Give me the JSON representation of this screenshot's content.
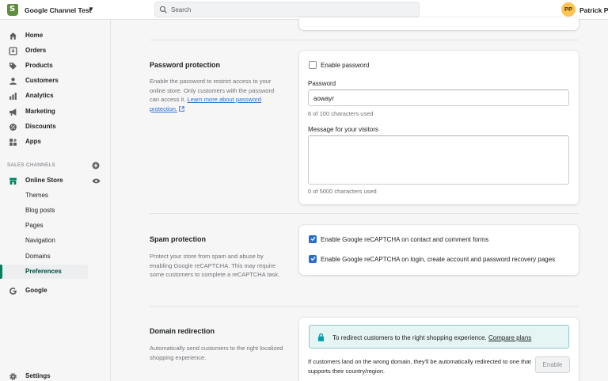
{
  "topbar": {
    "store_name": "Google Channel Test",
    "search_placeholder": "Search",
    "avatar_initials": "PP",
    "user_name": "Patrick Pie"
  },
  "sidebar": {
    "items": [
      {
        "label": "Home",
        "icon": "home-icon"
      },
      {
        "label": "Orders",
        "icon": "orders-icon"
      },
      {
        "label": "Products",
        "icon": "tag-icon"
      },
      {
        "label": "Customers",
        "icon": "person-icon"
      },
      {
        "label": "Analytics",
        "icon": "bar-chart-icon"
      },
      {
        "label": "Marketing",
        "icon": "megaphone-icon"
      },
      {
        "label": "Discounts",
        "icon": "discount-icon"
      },
      {
        "label": "Apps",
        "icon": "apps-icon"
      }
    ],
    "sales_channels_title": "SALES CHANNELS",
    "online_store": "Online Store",
    "subitems": [
      "Themes",
      "Blog posts",
      "Pages",
      "Navigation",
      "Domains",
      "Preferences"
    ],
    "google": "Google",
    "settings": "Settings"
  },
  "password": {
    "title": "Password protection",
    "desc_prefix": "Enable the password to restrict access to your online store. Only customers with the password can access it.",
    "learn_more": "Learn more about password protection.",
    "enable_label": "Enable password",
    "password_label": "Password",
    "password_value": "aowayr",
    "password_count": "6 of 100 characters used",
    "message_label": "Message for your visitors",
    "message_count": "0 of 5000 characters used"
  },
  "spam": {
    "title": "Spam protection",
    "desc": "Protect your store from spam and abuse by enabling Google reCAPTCHA. This may require some customers to complete a reCAPTCHA task.",
    "option1": "Enable Google reCAPTCHA on contact and comment forms",
    "option2": "Enable Google reCAPTCHA on login, create account and password recovery pages"
  },
  "domain": {
    "title": "Domain redirection",
    "desc": "Automatically send customers to the right localized shopping experience.",
    "banner_text": "To redirect customers to the right shopping experience.",
    "banner_link": "Compare plans",
    "redirect_desc": "If customers land on the wrong domain, they'll be automatically redirected to one that supports their country/region.",
    "enable_button": "Enable"
  },
  "colors": {
    "accent": "#008060",
    "checkbox": "#2c6ecb",
    "link": "#2c6ecb"
  }
}
